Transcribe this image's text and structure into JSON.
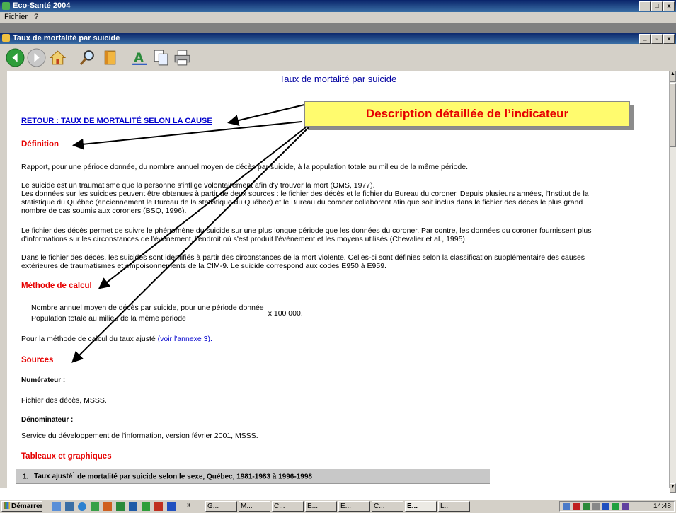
{
  "outer_window": {
    "title": "Eco-Santé 2004",
    "controls": [
      "_",
      "□",
      "x"
    ]
  },
  "menu": {
    "items": [
      "Fichier",
      "?"
    ]
  },
  "inner_window": {
    "title": "Taux de mortalité par suicide",
    "controls": [
      "_",
      "▫",
      "x"
    ]
  },
  "toolbar": {
    "icons": [
      "back-icon",
      "forward-icon",
      "home-icon",
      "search-icon",
      "book-icon",
      "font-icon",
      "copy-icon",
      "print-icon"
    ]
  },
  "page": {
    "heading": "Taux de mortalité par suicide",
    "return_link": "RETOUR : TAUX DE MORTALITÉ SELON LA CAUSE",
    "callout": "Description détaillée de l’indicateur",
    "definition_title": "Définition",
    "definition_text": "Rapport, pour une période donnée, du nombre annuel moyen de décès par suicide, à la population totale au milieu de la même période.",
    "p1_lines": [
      "Le suicide est un traumatisme que la personne s'inflige volontairement afin d'y trouver la mort (OMS, 1977).",
      "Les données sur les suicides peuvent être obtenues à partir de deux sources : le fichier des décès et le fichier du Bureau du coroner. Depuis plusieurs années, l'Institut de la",
      "statistique du Québec (anciennement le Bureau de la statistique du Québec) et le Bureau du coroner collaborent afin que soit inclus dans le fichier des décès le plus grand",
      "nombre de cas soumis aux coroners (BSQ, 1996)."
    ],
    "p2_lines": [
      "Le fichier des décès permet de suivre le phénomène du suicide sur une plus longue période que les données du coroner. Par contre, les données du coroner fournissent plus",
      "d'informations sur les circonstances de l'événement, l'endroit où s'est produit l'événement et les moyens utilisés (Chevalier et al., 1995)."
    ],
    "p3_lines": [
      "Dans le fichier des décès, les suicides sont identifiés à partir des circonstances de la mort violente. Celles-ci sont définies selon la classification supplémentaire des causes",
      "extérieures de traumatismes et empoisonnements de la CIM-9. Le suicide correspond aux codes E950 à E959."
    ],
    "method_title": "Méthode de calcul",
    "formula_numerator": "Nombre annuel moyen de décès par suicide, pour une période donnée",
    "formula_denominator": "Population totale au milieu de la même période",
    "formula_factor": "x 100 000.",
    "adjusted_prefix": "Pour la méthode de calcul du taux ajusté",
    "adjusted_link": "(voir l'annexe 3).",
    "sources_title": "Sources",
    "numerator_label": "Numérateur :",
    "numerator_value": "Fichier des décès, MSSS.",
    "denominator_label": "Dénominateur :",
    "denominator_value": "Service du développement de l'information, version février 2001, MSSS.",
    "tables_title": "Tableaux et graphiques",
    "table_item_num": "1.",
    "table_item_a": "Taux ajusté",
    "table_item_sup": "1",
    "table_item_b": " de mortalité par suicide selon le sexe, Québec, 1981-1983 à 1996-1998"
  },
  "taskbar": {
    "start_label": "Démarrer",
    "tasks": [
      "G...",
      "M...",
      "C...",
      "E...",
      "E...",
      "C...",
      "E...",
      "L..."
    ],
    "clock": "14:48"
  },
  "colors": {
    "title_bar": "#0a246a",
    "accent_red": "#e60000",
    "callout_bg": "#fffb6e",
    "link": "#0000cc"
  }
}
